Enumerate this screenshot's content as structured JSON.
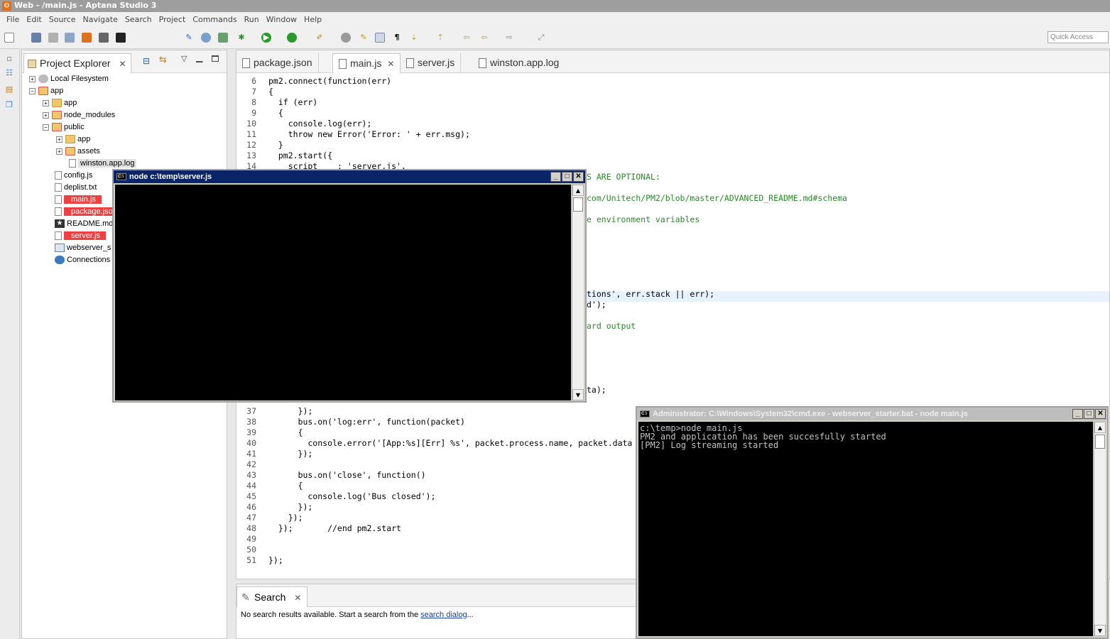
{
  "window": {
    "title": "Web - /main.js - Aptana Studio 3"
  },
  "menu": [
    "File",
    "Edit",
    "Source",
    "Navigate",
    "Search",
    "Project",
    "Commands",
    "Run",
    "Window",
    "Help"
  ],
  "toolbar": {
    "quick_access_placeholder": "Quick Access"
  },
  "explorer": {
    "tab_label": "Project Explorer",
    "tree": [
      {
        "label": "Local Filesystem"
      },
      {
        "label": "app"
      },
      {
        "label": "app"
      },
      {
        "label": "node_modules"
      },
      {
        "label": "public"
      },
      {
        "label": "app"
      },
      {
        "label": "assets"
      },
      {
        "label": "winston.app.log"
      },
      {
        "label": "config.js"
      },
      {
        "label": "deplist.txt"
      },
      {
        "label": "main.js"
      },
      {
        "label": "package.jso"
      },
      {
        "label": "README.md"
      },
      {
        "label": "server.js"
      },
      {
        "label": "webserver_s"
      },
      {
        "label": "Connections"
      }
    ]
  },
  "editor": {
    "tabs": [
      {
        "label": "package.json"
      },
      {
        "label": "main.js"
      },
      {
        "label": "server.js"
      },
      {
        "label": "winston.app.log"
      }
    ],
    "lines": [
      {
        "n": "6",
        "t": "pm2.connect(function(err)"
      },
      {
        "n": "7",
        "t": "{"
      },
      {
        "n": "8",
        "t": "  if (err)"
      },
      {
        "n": "9",
        "t": "  {"
      },
      {
        "n": "10",
        "t": "    console.log(err);"
      },
      {
        "n": "11",
        "t": "    throw new Error('Error: ' + err.msg);"
      },
      {
        "n": "12",
        "t": "  }"
      },
      {
        "n": "13",
        "t": "  pm2.start({"
      },
      {
        "n": "14",
        "t": "    script    : 'server.js',"
      }
    ],
    "right_fragments": [
      {
        "t": "S ARE OPTIONAL:"
      },
      {
        "t": "com/Unitech/PM2/blob/master/ADVANCED_README.md#schema"
      },
      {
        "t": "e environment variables"
      },
      {
        "t": "tions', err.stack || err);"
      },
      {
        "t": "d');"
      },
      {
        "t": "ard output"
      },
      {
        "t": "ta);"
      }
    ],
    "lines_bottom": [
      {
        "n": "37",
        "t": "      });"
      },
      {
        "n": "38",
        "t": "      bus.on('log:err', function(packet)"
      },
      {
        "n": "39",
        "t": "      {"
      },
      {
        "n": "40",
        "t": "        console.error('[App:%s][Err] %s', packet.process.name, packet.data"
      },
      {
        "n": "41",
        "t": "      });"
      },
      {
        "n": "42",
        "t": ""
      },
      {
        "n": "43",
        "t": "      bus.on('close', function()"
      },
      {
        "n": "44",
        "t": "      {"
      },
      {
        "n": "45",
        "t": "        console.log('Bus closed');"
      },
      {
        "n": "46",
        "t": "      });"
      },
      {
        "n": "47",
        "t": "    });"
      },
      {
        "n": "48",
        "t": "  });       //end pm2.start"
      },
      {
        "n": "49",
        "t": ""
      },
      {
        "n": "50",
        "t": ""
      },
      {
        "n": "51",
        "t": "});"
      }
    ]
  },
  "search": {
    "tab_label": "Search",
    "message_prefix": "No search results available. Start a search from the ",
    "link": "search dialog",
    "message_suffix": "..."
  },
  "console1": {
    "title": "node c:\\temp\\server.js",
    "output": ""
  },
  "console2": {
    "title": "Administrator: C:\\Windows\\System32\\cmd.exe - webserver_starter.bat - node  main.js",
    "output": "c:\\temp>node main.js\nPM2 and application has been succesfully started\n[PM2] Log streaming started"
  }
}
